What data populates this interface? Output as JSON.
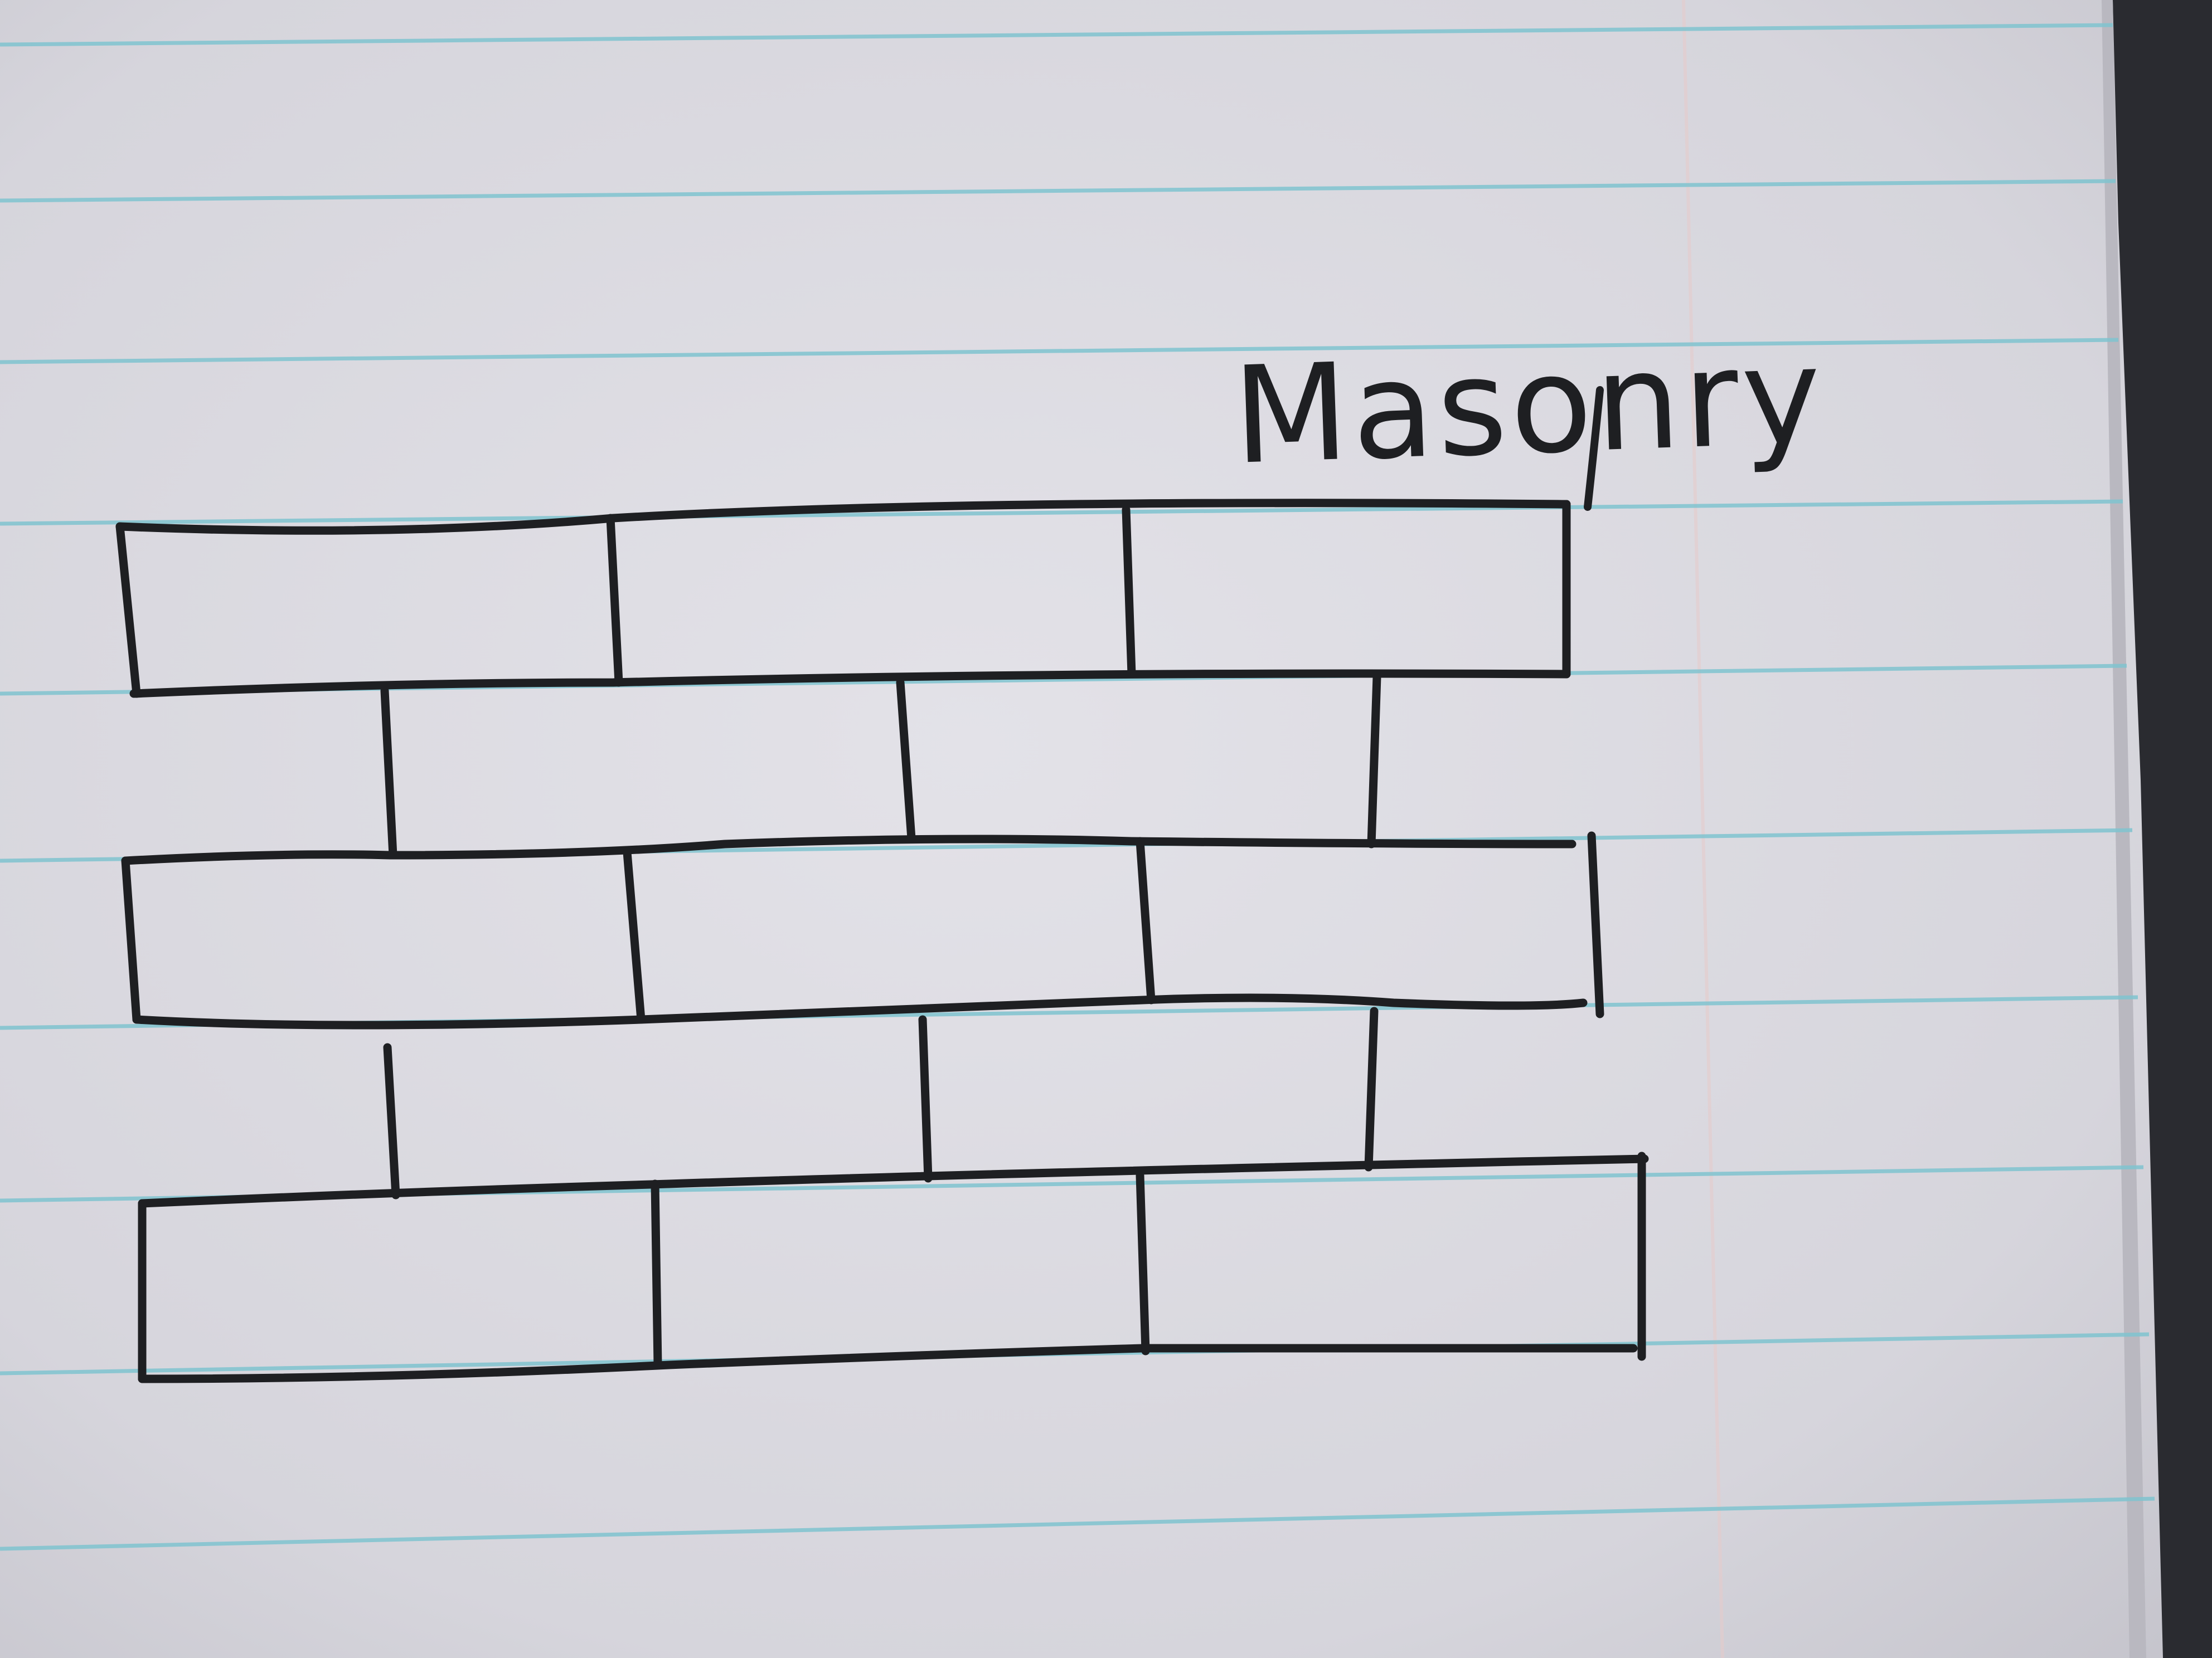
{
  "sketch": {
    "caption": "Masonry"
  },
  "colors": {
    "paper": "#dcdbe2",
    "paper_shadow": "#c9c8d0",
    "rule_line": "#7fc3cf",
    "margin_line": "#e8c8c8",
    "ink": "#1e1f22",
    "page_edge": "#2a2b30"
  }
}
